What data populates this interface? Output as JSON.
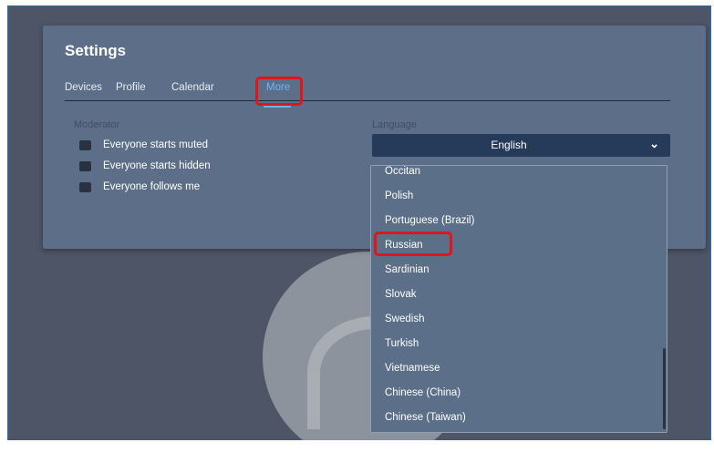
{
  "settings": {
    "title": "Settings",
    "tabs": [
      {
        "label": "Devices"
      },
      {
        "label": "Profile"
      },
      {
        "label": "Calendar"
      },
      {
        "label": "More",
        "active": true
      }
    ],
    "moderator": {
      "label": "Moderator",
      "options": [
        {
          "label": "Everyone starts muted",
          "checked": false
        },
        {
          "label": "Everyone starts hidden",
          "checked": false
        },
        {
          "label": "Everyone follows me",
          "checked": false
        }
      ]
    },
    "language": {
      "label": "Language",
      "selected": "English",
      "options": [
        "Occitan",
        "Polish",
        "Portuguese (Brazil)",
        "Russian",
        "Sardinian",
        "Slovak",
        "Swedish",
        "Turkish",
        "Vietnamese",
        "Chinese (China)",
        "Chinese (Taiwan)"
      ],
      "highlighted": "Russian"
    }
  },
  "colors": {
    "highlight": "#e0151b",
    "active_tab": "#69b4ff",
    "panel": "#5d6f88",
    "background": "#4d5566"
  },
  "icons": {
    "avatar": "user-avatar-icon",
    "dropdown": "chevron-down-icon"
  }
}
